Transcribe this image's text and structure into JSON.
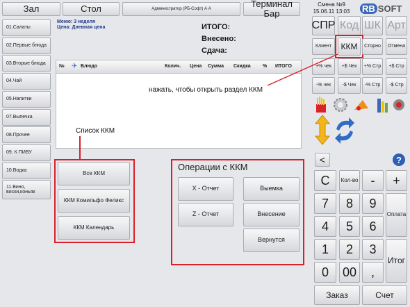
{
  "header": {
    "hall": "Зал",
    "table": "Стол",
    "user": "Администратор (РБ-Софт) А А",
    "terminal": "Терминал Бар",
    "shift": "Смена №9",
    "datetime": "15.06.11 13:03",
    "logo_left": "RB",
    "logo_right": "SOFT"
  },
  "sidebar": {
    "items": [
      "01.Салаты",
      "02.Первые блюда",
      "03.Вторые блюда",
      "04.Чай",
      "05.Напитки",
      "07.Выпечка",
      "08.Прочее",
      "09. К ПИВУ",
      "10.Водка",
      "11.Вино, виски,коньяк"
    ]
  },
  "menu_info": {
    "menu": "Меню: 3 неделя",
    "price": "Цена: Дневная цена"
  },
  "totals": {
    "total": "ИТОГО:",
    "paid": "Внесено:",
    "change": "Сдача:"
  },
  "table": {
    "columns": [
      "№",
      "Блюдо",
      "Колич.",
      "Цена",
      "Сумма",
      "Скидка",
      "%",
      "ИТОГО"
    ]
  },
  "annotations": {
    "kkm_hint": "нажать, чтобы открыть раздел ККМ",
    "kkm_list": "Список ККМ"
  },
  "kkm_list": {
    "buttons": [
      "Все ККМ",
      "ККМ Комильфо Феликс",
      "ККМ Календарь"
    ]
  },
  "kkm_ops": {
    "title": "Операции с ККМ",
    "x_report": "X - Отчет",
    "z_report": "Z - Отчет",
    "withdraw": "Выемка",
    "deposit": "Внесение",
    "return": "Вернутся"
  },
  "right_panel": {
    "row1": [
      "СПР",
      "Код",
      "ШК",
      "Арт"
    ],
    "row2": [
      "Клиент",
      "ККМ",
      "Сторно",
      "Отмена"
    ],
    "row3": [
      "+% чек",
      "+$ Чек",
      "+% Стр",
      "+$ Стр"
    ],
    "row4": [
      "-% чек",
      "-$ Чек",
      "-% Стр",
      "-$ Стр"
    ],
    "back": "<",
    "help": "?",
    "clear": "C",
    "qty": "Кол-во",
    "minus": "-",
    "plus": "+",
    "digits": [
      "7",
      "8",
      "9",
      "4",
      "5",
      "6",
      "1",
      "2",
      "3",
      "0",
      "00",
      ","
    ],
    "pay": "Оплата",
    "total": "Итог",
    "order": "Заказ",
    "bill": "Счет"
  }
}
